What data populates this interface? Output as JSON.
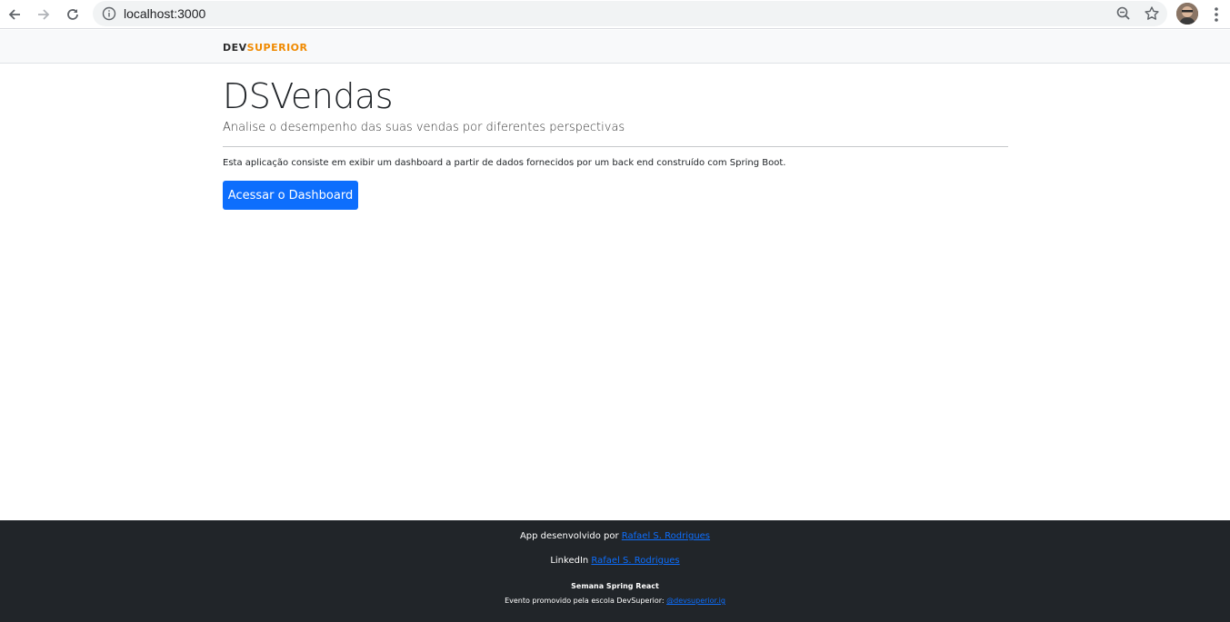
{
  "browser": {
    "url": "localhost:3000"
  },
  "navbar": {
    "brand_dev": "DEV",
    "brand_superior": "SUPERIOR"
  },
  "main": {
    "title": "DSVendas",
    "subtitle": "Analise o desempenho das suas vendas por diferentes perspectivas",
    "description": "Esta aplicação consiste em exibir um dashboard a partir de dados fornecidos por um back end construído com Spring Boot.",
    "cta_label": "Acessar o Dashboard"
  },
  "footer": {
    "dev_prefix": "App desenvolvido por ",
    "dev_link": "Rafael S. Rodrigues",
    "linkedin_prefix": "LinkedIn ",
    "linkedin_link": "Rafael S. Rodrigues",
    "event_title": "Semana Spring React",
    "event_prefix": "Evento promovido pela escola DevSuperior: ",
    "event_link": "@devsuperior.ig"
  },
  "colors": {
    "primary": "#0d6efd",
    "brand_orange": "#f08a00",
    "footer_bg": "#212529",
    "navbar_bg": "#f8f9fa"
  },
  "icons": [
    "back-arrow-icon",
    "forward-arrow-icon",
    "reload-icon",
    "info-icon",
    "zoom-icon",
    "star-icon",
    "avatar",
    "kebab-menu-icon"
  ]
}
